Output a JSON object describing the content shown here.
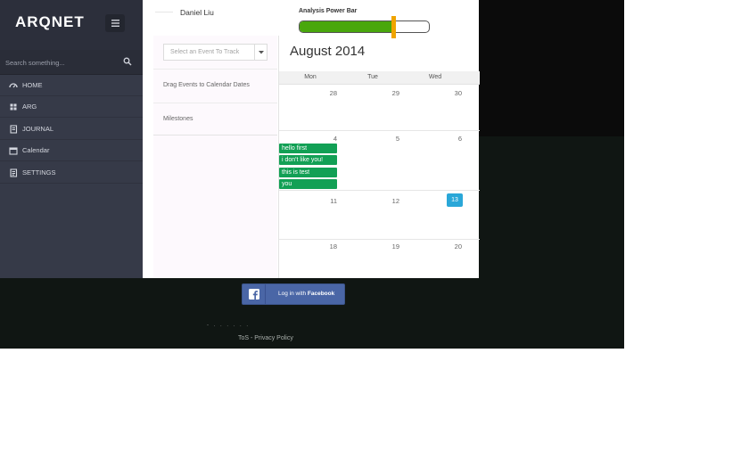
{
  "sidebar": {
    "logo": "ARQNET",
    "search_placeholder": "Search something...",
    "items": [
      {
        "label": "HOME",
        "icon": "dashboard-icon"
      },
      {
        "label": "ARG",
        "icon": "grid-icon"
      },
      {
        "label": "JOURNAL",
        "icon": "book-icon"
      },
      {
        "label": "Calendar",
        "icon": "calendar-icon"
      },
      {
        "label": "SETTINGS",
        "icon": "document-icon"
      }
    ]
  },
  "header": {
    "user_name": "Daniel Liu",
    "power_bar_label": "Analysis Power Bar",
    "power_level": 0.73
  },
  "left_panel": {
    "event_select_placeholder": "Select an Event To Track",
    "drag_hint": "Drag Events to Calendar Dates",
    "milestones": "Milestones"
  },
  "calendar": {
    "title": "August 2014",
    "days_of_week": [
      "Mon",
      "Tue",
      "Wed"
    ],
    "weeks": [
      [
        "28",
        "29",
        "30"
      ],
      [
        "4",
        "5",
        "6"
      ],
      [
        "11",
        "12",
        "13"
      ],
      [
        "18",
        "19",
        "20"
      ]
    ],
    "today": "13",
    "events": [
      "hello first",
      "i don't like you!",
      "this is test",
      "you"
    ],
    "colors": {
      "event": "#12a055",
      "today": "#2aa7d8"
    }
  },
  "footer": {
    "facebook_prefix": "Log in with",
    "facebook_brand": "Facebook",
    "links": "ToS - Privacy Policy",
    "dots": "- . . . . . ."
  }
}
